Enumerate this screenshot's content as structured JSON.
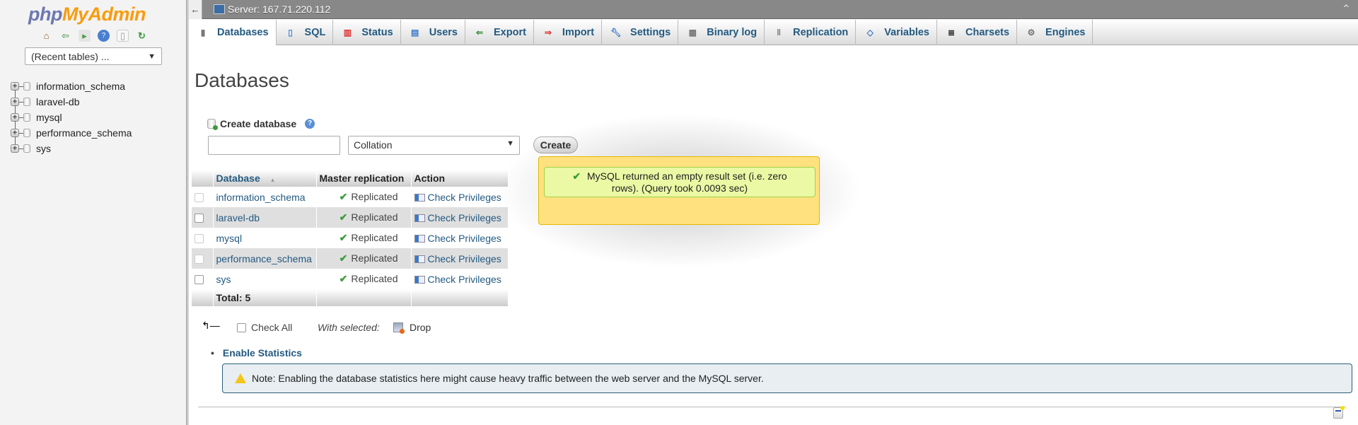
{
  "sidebar": {
    "logo_php": "php",
    "logo_myadmin": "MyAdmin",
    "nav_icons": [
      "home-icon",
      "logout-icon",
      "query-window-icon",
      "docs-icon",
      "sql-docs-icon",
      "reload-icon"
    ],
    "recent_tables": "(Recent tables) ...",
    "databases": [
      "information_schema",
      "laravel-db",
      "mysql",
      "performance_schema",
      "sys"
    ]
  },
  "topbar": {
    "back_label": "←",
    "server": "Server: 167.71.220.112",
    "collapse_label": "⌃"
  },
  "tabs": [
    {
      "label": "Databases",
      "icon": "database-icon",
      "active": true
    },
    {
      "label": "SQL",
      "icon": "sql-icon"
    },
    {
      "label": "Status",
      "icon": "status-icon"
    },
    {
      "label": "Users",
      "icon": "users-icon"
    },
    {
      "label": "Export",
      "icon": "export-icon"
    },
    {
      "label": "Import",
      "icon": "import-icon"
    },
    {
      "label": "Settings",
      "icon": "settings-icon"
    },
    {
      "label": "Binary log",
      "icon": "binary-log-icon"
    },
    {
      "label": "Replication",
      "icon": "replication-icon"
    },
    {
      "label": "Variables",
      "icon": "variables-icon"
    },
    {
      "label": "Charsets",
      "icon": "charsets-icon"
    },
    {
      "label": "Engines",
      "icon": "engines-icon"
    }
  ],
  "main": {
    "title": "Databases",
    "create_label": "Create database",
    "db_name_value": "",
    "collation_selected": "Collation",
    "create_button": "Create"
  },
  "table": {
    "headers": {
      "database": "Database",
      "sort_indicator": "▲",
      "replication": "Master replication",
      "action": "Action"
    },
    "rows": [
      {
        "name": "information_schema",
        "replication": "Replicated",
        "action": "Check Privileges",
        "checkbox_enabled": false
      },
      {
        "name": "laravel-db",
        "replication": "Replicated",
        "action": "Check Privileges",
        "checkbox_enabled": true
      },
      {
        "name": "mysql",
        "replication": "Replicated",
        "action": "Check Privileges",
        "checkbox_enabled": false
      },
      {
        "name": "performance_schema",
        "replication": "Replicated",
        "action": "Check Privileges",
        "checkbox_enabled": false
      },
      {
        "name": "sys",
        "replication": "Replicated",
        "action": "Check Privileges",
        "checkbox_enabled": true
      }
    ],
    "total": "Total: 5"
  },
  "popup": {
    "message": "MySQL returned an empty result set (i.e. zero rows). (Query took 0.0093 sec)"
  },
  "bulk": {
    "check_all": "Check All",
    "with_selected": "With selected:",
    "drop": "Drop"
  },
  "stats": {
    "enable_link": "Enable Statistics",
    "note": "Note: Enabling the database statistics here might cause heavy traffic between the web server and the MySQL server."
  },
  "colors": {
    "link": "#235a81",
    "popup_bg": "#ffe17f",
    "success_bg": "#ebf8a4",
    "note_bg": "#e8eef1"
  }
}
